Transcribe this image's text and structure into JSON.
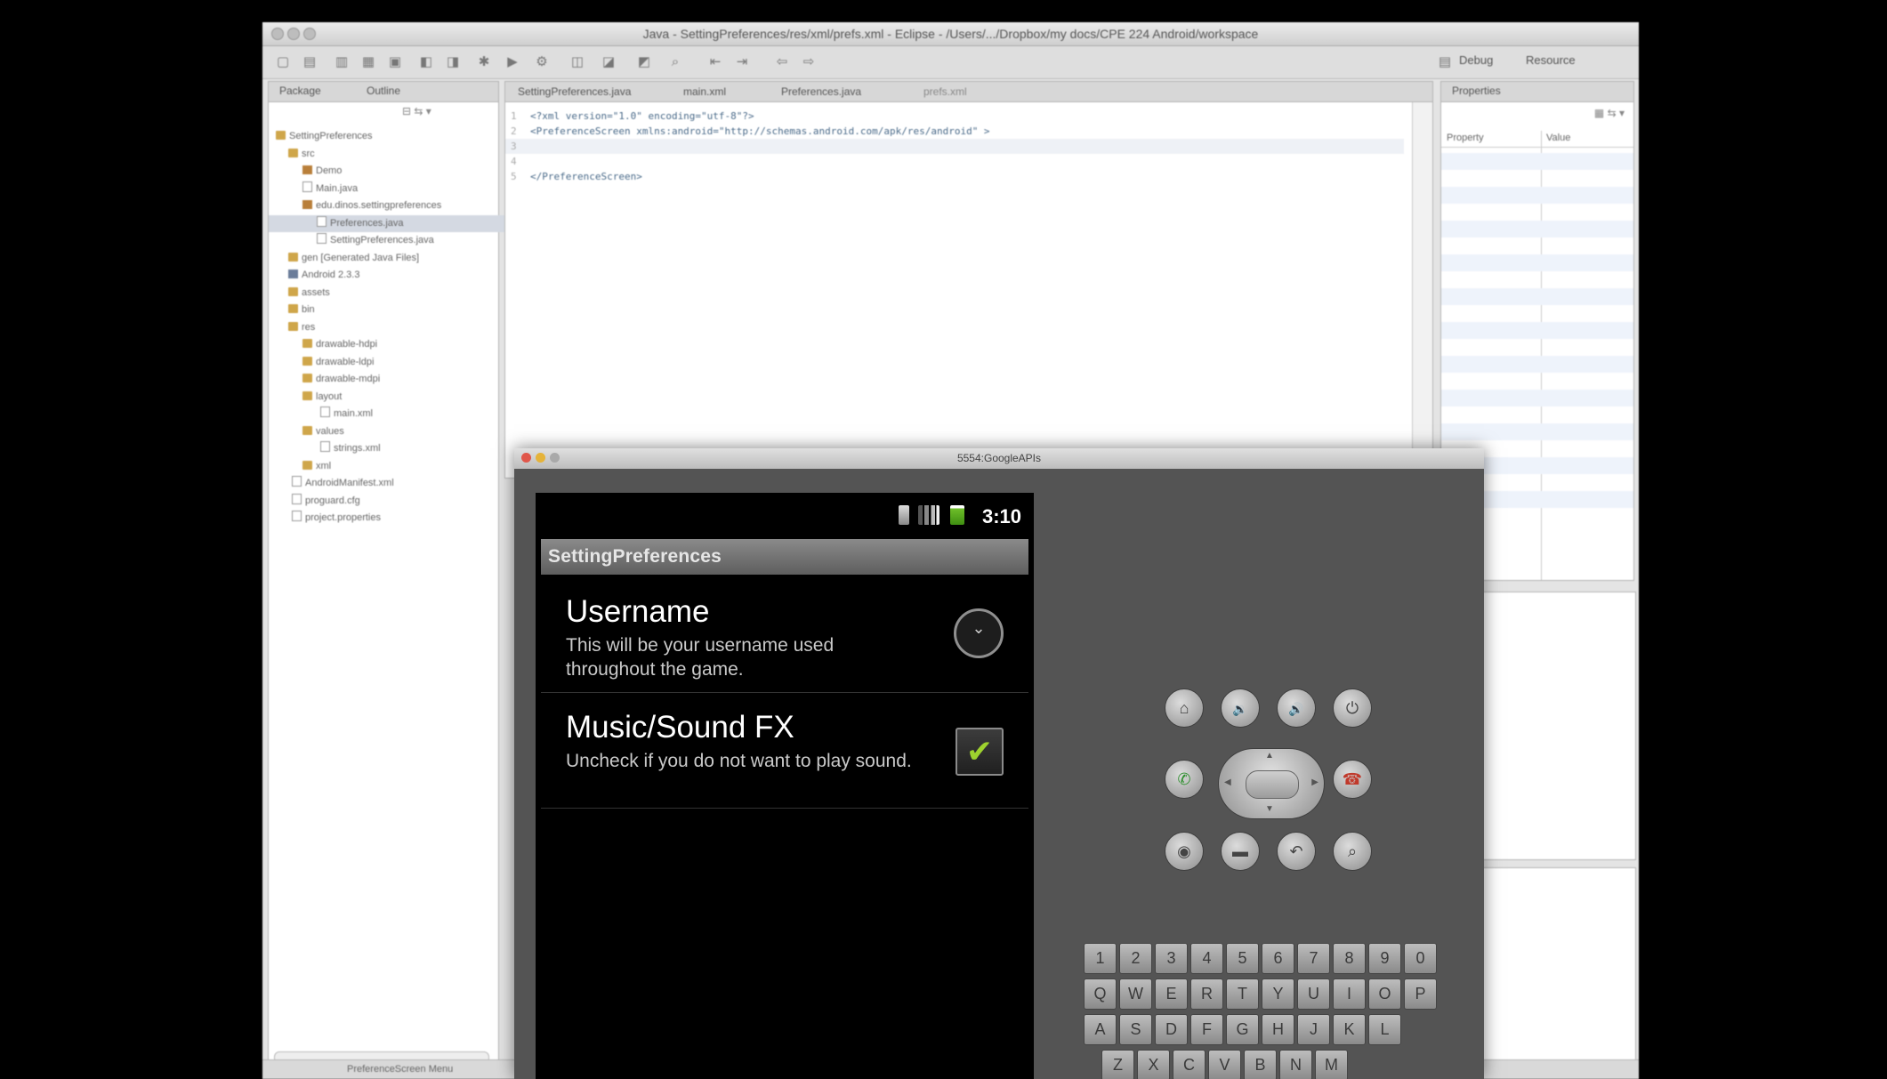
{
  "eclipse": {
    "title": "Java - SettingPreferences/res/xml/prefs.xml - Eclipse - /Users/.../Dropbox/my docs/CPE 224 Android/workspace",
    "perspectives": [
      "Debug",
      "Resource"
    ],
    "pkg_tabs": [
      "Package",
      "Outline"
    ],
    "editor_tabs": [
      "SettingPreferences.java",
      "main.xml",
      "Preferences.java",
      "prefs.xml"
    ],
    "props_tab": "Properties",
    "props_cols": [
      "Property",
      "Value"
    ],
    "tree": [
      "SettingPreferences",
      "src",
      "Demo",
      "Main.java",
      "edu.dinos.settingpreferences",
      "Preferences.java",
      "SettingPreferences.java",
      "gen [Generated Java Files]",
      "Android 2.3.3",
      "assets",
      "bin",
      "res",
      "drawable-hdpi",
      "drawable-ldpi",
      "drawable-mdpi",
      "layout",
      "main.xml",
      "values",
      "strings.xml",
      "xml",
      "AndroidManifest.xml",
      "proguard.cfg",
      "project.properties"
    ],
    "code": [
      "<?xml version=\"1.0\" encoding=\"utf-8\"?>",
      "<PreferenceScreen xmlns:android=\"http://schemas.android.com/apk/res/android\" >",
      "",
      "",
      "</PreferenceScreen>"
    ],
    "status": "PreferenceScreen Menu"
  },
  "emulator": {
    "title": "5554:GoogleAPIs",
    "clock": "3:10",
    "app_title": "SettingPreferences",
    "prefs": [
      {
        "title": "Username",
        "summary": "This will be your username used throughout the game.",
        "widget": "dropdown"
      },
      {
        "title": "Music/Sound FX",
        "summary": "Uncheck if you do not want to play sound.",
        "widget": "checkbox",
        "checked": true
      }
    ],
    "keys_row1": [
      "1",
      "2",
      "3",
      "4",
      "5",
      "6",
      "7",
      "8",
      "9",
      "0"
    ],
    "keys_row2": [
      "Q",
      "W",
      "E",
      "R",
      "T",
      "Y",
      "U",
      "I",
      "O",
      "P"
    ],
    "keys_row3": [
      "A",
      "S",
      "D",
      "F",
      "G",
      "H",
      "J",
      "K",
      "L"
    ],
    "keys_row4": [
      "Z",
      "X",
      "C",
      "V",
      "B",
      "N",
      "M"
    ]
  },
  "icons": {
    "check": "✔",
    "chevron": "⌄",
    "home": "⌂",
    "vol_down": "🔉",
    "vol_up": "🔊",
    "power": "⏻",
    "call": "✆",
    "end_call": "☎",
    "camera": "◉",
    "menu": "▬",
    "back": "↶",
    "search": "⌕"
  },
  "colors": {
    "checkmark": "#9ed22e",
    "android_titlebar": "#7a7a7a"
  }
}
